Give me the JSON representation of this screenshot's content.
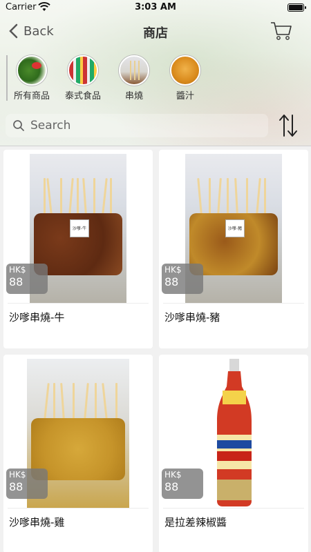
{
  "status": {
    "carrier": "Carrier",
    "time": "3:03 AM"
  },
  "nav": {
    "back_label": "Back",
    "title": "商店"
  },
  "categories": [
    {
      "label": "所有商品"
    },
    {
      "label": "泰式食品"
    },
    {
      "label": "串燒"
    },
    {
      "label": "醬汁"
    }
  ],
  "search": {
    "placeholder": "Search"
  },
  "products": [
    {
      "currency": "HK$",
      "price": "88",
      "name": "沙嗲串燒-牛",
      "tag": "沙嗲-牛"
    },
    {
      "currency": "HK$",
      "price": "88",
      "name": "沙嗲串燒-豬",
      "tag": "沙嗲-豬"
    },
    {
      "currency": "HK$",
      "price": "88",
      "name": "沙嗲串燒-雞",
      "tag": ""
    },
    {
      "currency": "HK$",
      "price": "88",
      "name": "是拉差辣椒醬",
      "tag": ""
    }
  ],
  "colors": {
    "price_badge": "#787878",
    "card_bg": "#ffffff",
    "page_bg": "#f1f1f1"
  }
}
